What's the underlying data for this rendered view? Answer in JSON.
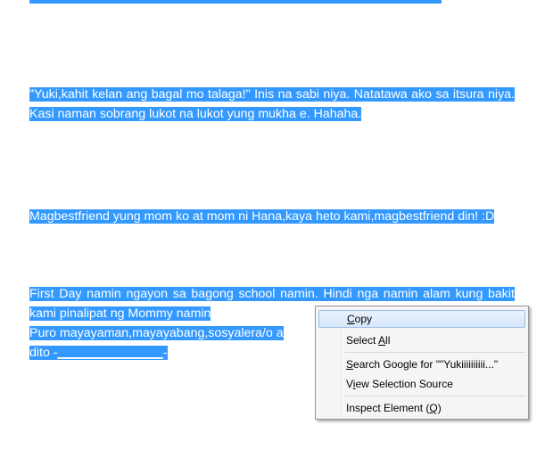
{
  "document": {
    "paragraphs": [
      "\"Yuki,kahit kelan ang bagal mo talaga!\" Inis na sabi niya. Natatawa ako sa itsura niya. Kasi naman sobrang lukot na lukot yung mukha e. Hahaha.",
      "Magbestfriend yung mom ko at mom ni Hana,kaya heto kami,magbestfriend din! :D",
      "First Day namin ngayon sa bagong school namin. Hindi nga namin alam kung bakit kami pinalipat ng Mommy namin",
      "Puro mayayaman,mayayabang,sosyalera/o a",
      "dito -"
    ],
    "blank_line": "_______________",
    "trailing_dash": "-"
  },
  "context_menu": {
    "items": [
      {
        "label": "Copy",
        "accel": "C"
      },
      {
        "label": "Select All",
        "accel": "A"
      },
      {
        "label": "Search Google for \"\"Yukiiiiiiiiii...\"",
        "accel": "S"
      },
      {
        "label": "View Selection Source",
        "accel": "i"
      },
      {
        "label": "Inspect Element (Q)",
        "accel": "Q"
      }
    ]
  },
  "colors": {
    "selection": "#3399ff",
    "menu_bg": "#f5f5f5",
    "menu_highlight": "#d6e7fb"
  }
}
